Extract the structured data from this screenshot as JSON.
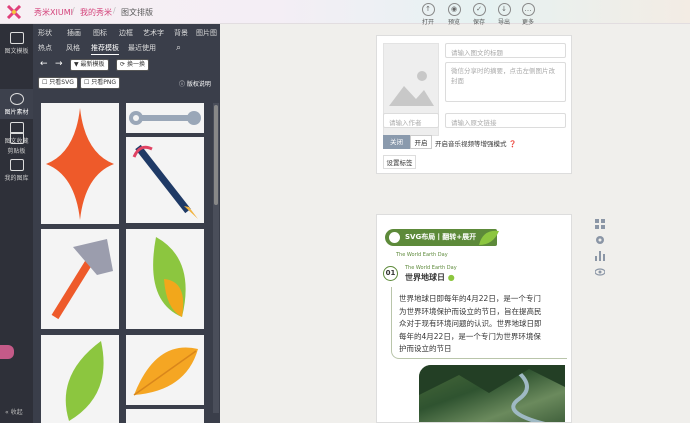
{
  "header": {
    "brand": "秀米XIUMI",
    "crumbs": [
      "我的秀米",
      "图文排版"
    ],
    "toolbar": [
      {
        "label": "打开",
        "icon": "open-icon"
      },
      {
        "label": "预览",
        "icon": "preview-icon"
      },
      {
        "label": "保存",
        "icon": "save-icon"
      },
      {
        "label": "导出",
        "icon": "export-icon"
      },
      {
        "label": "更多",
        "icon": "more-icon"
      }
    ]
  },
  "rail": [
    {
      "label": "图文模板",
      "icon": "template-icon"
    },
    {
      "label": "图片素材",
      "icon": "image-icon"
    },
    {
      "label": "图文收藏",
      "icon": "favorite-icon"
    },
    {
      "label": "剪贴板",
      "icon": "clipboard-icon"
    },
    {
      "label": "我的图库",
      "icon": "gallery-icon"
    }
  ],
  "panel": {
    "tabs1": [
      "形状",
      "插画",
      "图标",
      "边框",
      "艺术字",
      "背景",
      "图片图"
    ],
    "tabs2": [
      "热点",
      "风格",
      "推荐模板",
      "最近使用"
    ],
    "active_tab": "推荐模板",
    "new_template": "最新模板",
    "swap": "换一换",
    "only_svg": "只看SVG",
    "only_png": "只看PNG",
    "copyright": "版权说明"
  },
  "collapse": "收起",
  "editor1": {
    "title_ph": "请输入图文的标题",
    "summary_ph": "微信分享时的摘要，点击左侧图片改封面",
    "author_ph": "请输入作者",
    "link_ph": "请输入原文链接",
    "close_btn": "关闭",
    "open_btn": "开启",
    "music_label": "开启音乐视频等增强模式",
    "tags_btn": "设置标签"
  },
  "editor2": {
    "banner": "SVG布局丨翻转+展开",
    "subtitle": "The World Earth Day",
    "num": "01",
    "section_en": "The World Earth Day",
    "section_title": "世界地球日",
    "body": "世界地球日即每年的4月22日，是一个专门为世界环境保护而设立的节日，旨在提高民众对于现有环境问题的认识。世界地球日即每年的4月22日，是一个专门为世界环境保护而设立的节日"
  },
  "colors": {
    "accent": "#d4457c",
    "green": "#5d8a3a",
    "dark_panel": "#3a3e4a"
  }
}
